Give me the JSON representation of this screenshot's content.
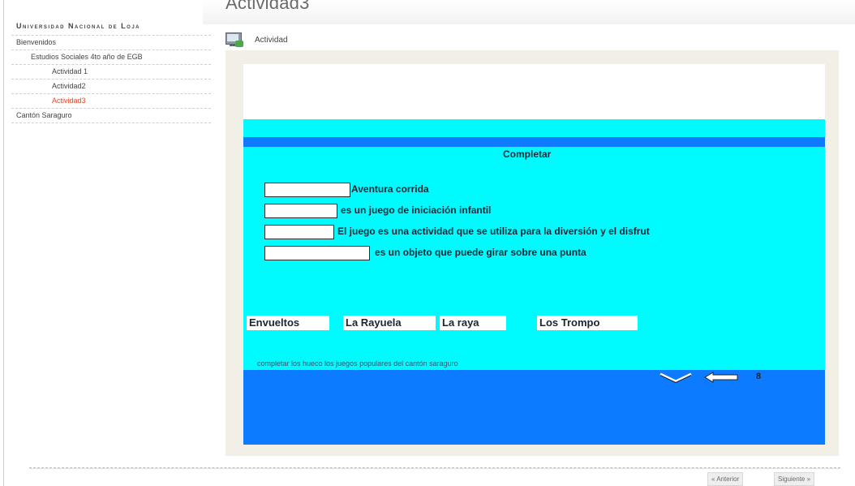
{
  "page": {
    "top_title": "Actividad3"
  },
  "sidebar": {
    "university": "Universidad Nacional de Loja",
    "items": [
      {
        "label": "Bienvenidos",
        "level": 0,
        "active": false
      },
      {
        "label": "Estudios Sociales 4to año de EGB",
        "level": 1,
        "active": false
      },
      {
        "label": "Actividad 1",
        "level": 2,
        "active": false
      },
      {
        "label": "Actividad2",
        "level": 2,
        "active": false
      },
      {
        "label": "Actividad3",
        "level": 2,
        "active": true
      },
      {
        "label": "Cantón Saraguro",
        "level": 0,
        "active": false
      }
    ]
  },
  "activity": {
    "label": "Actividad",
    "icon": "monitor-activity-icon",
    "title": "Completar",
    "sentences": [
      "Aventura corrida",
      "es un juego de iniciación infantil",
      "El juego es una actividad que se utiliza para la diversión y el disfrut",
      "es un objeto que puede girar sobre una punta"
    ],
    "words": [
      "Envueltos",
      "La Rayuela",
      "La raya",
      "Los Trompo"
    ],
    "instructions": "completar los hueco los juegos populares del cantón saraguro",
    "score": "8"
  },
  "navigation": {
    "prev_label": "« Anterior",
    "next_label": "Siguiente »"
  },
  "colors": {
    "cyan": "#00fbff",
    "blue": "#0d7bff",
    "active_link": "#e6482b",
    "frame_bg": "#f2f0e6"
  }
}
